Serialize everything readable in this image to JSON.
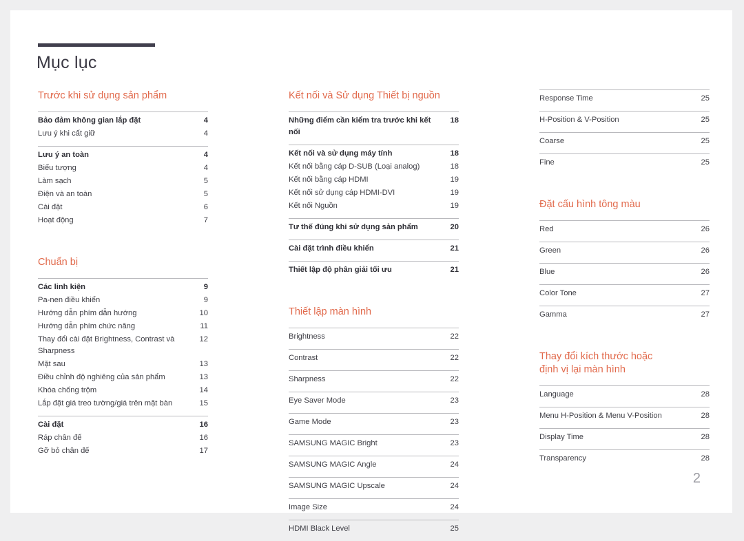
{
  "document": {
    "title": "Mục lục",
    "page_number": "2",
    "accent_color": "#e1694b",
    "rule_color": "#413f4d"
  },
  "columns": [
    {
      "sections": [
        {
          "title": "Trước khi sử dụng sản phẩm",
          "groups": [
            {
              "entries": [
                {
                  "label": "Bảo đảm không gian lắp đặt",
                  "page": "4",
                  "bold": true
                },
                {
                  "label": "Lưu ý khi cất giữ",
                  "page": "4",
                  "bold": false
                }
              ]
            },
            {
              "entries": [
                {
                  "label": "Lưu ý an toàn",
                  "page": "4",
                  "bold": true
                },
                {
                  "label": "Biểu tượng",
                  "page": "4",
                  "bold": false
                },
                {
                  "label": "Làm sạch",
                  "page": "5",
                  "bold": false
                },
                {
                  "label": "Điện và an toàn",
                  "page": "5",
                  "bold": false
                },
                {
                  "label": "Cài đặt",
                  "page": "6",
                  "bold": false
                },
                {
                  "label": "Hoạt động",
                  "page": "7",
                  "bold": false
                }
              ]
            }
          ]
        },
        {
          "title": "Chuẩn bị",
          "groups": [
            {
              "entries": [
                {
                  "label": "Các linh kiện",
                  "page": "9",
                  "bold": true
                },
                {
                  "label": "Pa-nen điều khiển",
                  "page": "9",
                  "bold": false
                },
                {
                  "label": "Hướng dẫn phím dẫn hướng",
                  "page": "10",
                  "bold": false
                },
                {
                  "label": "Hướng dẫn phím chức năng",
                  "page": "11",
                  "bold": false
                },
                {
                  "label": "Thay đổi cài đặt Brightness, Contrast và Sharpness",
                  "page": "12",
                  "bold": false
                },
                {
                  "label": "Mặt sau",
                  "page": "13",
                  "bold": false
                },
                {
                  "label": "Điều chỉnh độ nghiêng của sản phẩm",
                  "page": "13",
                  "bold": false
                },
                {
                  "label": "Khóa chống trộm",
                  "page": "14",
                  "bold": false
                },
                {
                  "label": "Lắp đặt giá treo tường/giá trên mặt bàn",
                  "page": "15",
                  "bold": false
                }
              ]
            },
            {
              "entries": [
                {
                  "label": "Cài đặt",
                  "page": "16",
                  "bold": true
                },
                {
                  "label": "Ráp chân đế",
                  "page": "16",
                  "bold": false
                },
                {
                  "label": "Gỡ bỏ chân đế",
                  "page": "17",
                  "bold": false
                }
              ]
            }
          ]
        }
      ]
    },
    {
      "sections": [
        {
          "title": "Kết nối và Sử dụng Thiết bị nguồn",
          "groups": [
            {
              "entries": [
                {
                  "label": "Những điểm cần kiểm tra trước khi kết nối",
                  "page": "18",
                  "bold": true
                }
              ]
            },
            {
              "entries": [
                {
                  "label": "Kết nối và sử dụng máy tính",
                  "page": "18",
                  "bold": true
                },
                {
                  "label": "Kết nối bằng cáp D-SUB (Loại analog)",
                  "page": "18",
                  "bold": false
                },
                {
                  "label": "Kết nối bằng cáp HDMI",
                  "page": "19",
                  "bold": false
                },
                {
                  "label": "Kết nối sử dụng cáp HDMI-DVI",
                  "page": "19",
                  "bold": false
                },
                {
                  "label": "Kết nối Nguồn",
                  "page": "19",
                  "bold": false
                }
              ]
            },
            {
              "entries": [
                {
                  "label": "Tư thế đúng khi sử dụng sản phẩm",
                  "page": "20",
                  "bold": true
                }
              ]
            },
            {
              "entries": [
                {
                  "label": "Cài đặt trình điều khiển",
                  "page": "21",
                  "bold": true
                }
              ]
            },
            {
              "entries": [
                {
                  "label": "Thiết lập độ phân giải tối ưu",
                  "page": "21",
                  "bold": true
                }
              ]
            }
          ]
        },
        {
          "title": "Thiết lập màn hình",
          "groups": [
            {
              "entries": [
                {
                  "label": "Brightness",
                  "page": "22",
                  "bold": false
                }
              ]
            },
            {
              "entries": [
                {
                  "label": "Contrast",
                  "page": "22",
                  "bold": false
                }
              ]
            },
            {
              "entries": [
                {
                  "label": "Sharpness",
                  "page": "22",
                  "bold": false
                }
              ]
            },
            {
              "entries": [
                {
                  "label": "Eye Saver Mode",
                  "page": "23",
                  "bold": false
                }
              ]
            },
            {
              "entries": [
                {
                  "label": "Game Mode",
                  "page": "23",
                  "bold": false
                }
              ]
            },
            {
              "entries": [
                {
                  "label": "SAMSUNG MAGIC Bright",
                  "page": "23",
                  "bold": false
                }
              ]
            },
            {
              "entries": [
                {
                  "label": "SAMSUNG MAGIC Angle",
                  "page": "24",
                  "bold": false
                }
              ]
            },
            {
              "entries": [
                {
                  "label": "SAMSUNG MAGIC Upscale",
                  "page": "24",
                  "bold": false
                }
              ]
            },
            {
              "entries": [
                {
                  "label": "Image Size",
                  "page": "24",
                  "bold": false
                }
              ]
            },
            {
              "entries": [
                {
                  "label": "HDMI Black Level",
                  "page": "25",
                  "bold": false
                }
              ]
            }
          ]
        }
      ]
    },
    {
      "sections": [
        {
          "title": "",
          "groups": [
            {
              "entries": [
                {
                  "label": "Response Time",
                  "page": "25",
                  "bold": false
                }
              ]
            },
            {
              "entries": [
                {
                  "label": "H-Position & V-Position",
                  "page": "25",
                  "bold": false
                }
              ]
            },
            {
              "entries": [
                {
                  "label": "Coarse",
                  "page": "25",
                  "bold": false
                }
              ]
            },
            {
              "entries": [
                {
                  "label": "Fine",
                  "page": "25",
                  "bold": false
                }
              ]
            }
          ]
        },
        {
          "title": "Đặt cấu hình tông màu",
          "groups": [
            {
              "entries": [
                {
                  "label": "Red",
                  "page": "26",
                  "bold": false
                }
              ]
            },
            {
              "entries": [
                {
                  "label": "Green",
                  "page": "26",
                  "bold": false
                }
              ]
            },
            {
              "entries": [
                {
                  "label": "Blue",
                  "page": "26",
                  "bold": false
                }
              ]
            },
            {
              "entries": [
                {
                  "label": "Color Tone",
                  "page": "27",
                  "bold": false
                }
              ]
            },
            {
              "entries": [
                {
                  "label": "Gamma",
                  "page": "27",
                  "bold": false
                }
              ]
            }
          ]
        },
        {
          "title": "Thay đổi kích thước hoặc\nđịnh vị lại màn hình",
          "groups": [
            {
              "entries": [
                {
                  "label": "Language",
                  "page": "28",
                  "bold": false
                }
              ]
            },
            {
              "entries": [
                {
                  "label": "Menu H-Position & Menu V-Position",
                  "page": "28",
                  "bold": false
                }
              ]
            },
            {
              "entries": [
                {
                  "label": "Display Time",
                  "page": "28",
                  "bold": false
                }
              ]
            },
            {
              "entries": [
                {
                  "label": "Transparency",
                  "page": "28",
                  "bold": false
                }
              ]
            }
          ]
        }
      ]
    }
  ]
}
